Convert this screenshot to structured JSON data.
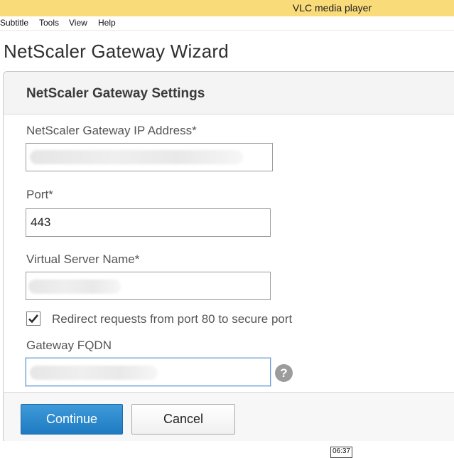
{
  "window": {
    "title": "VLC media player"
  },
  "menubar": {
    "items": [
      "Subtitle",
      "Tools",
      "View",
      "Help"
    ]
  },
  "wizard": {
    "title": "NetScaler Gateway Wizard"
  },
  "settings": {
    "header": "NetScaler Gateway Settings",
    "ip_label": "NetScaler Gateway IP Address*",
    "ip_value": "",
    "port_label": "Port*",
    "port_value": "443",
    "vserver_label": "Virtual Server Name*",
    "vserver_value": "",
    "redirect_label": "Redirect requests from port 80 to secure port",
    "redirect_checked": true,
    "fqdn_label": "Gateway FQDN",
    "fqdn_value": "",
    "help_glyph": "?"
  },
  "buttons": {
    "continue": "Continue",
    "cancel": "Cancel"
  },
  "status": {
    "time": "06:37"
  },
  "icons": {
    "checkbox": "checkmark-icon",
    "help": "help-icon"
  },
  "colors": {
    "titlebar": "#f9db7a",
    "primary_button": "#2a87cc"
  }
}
